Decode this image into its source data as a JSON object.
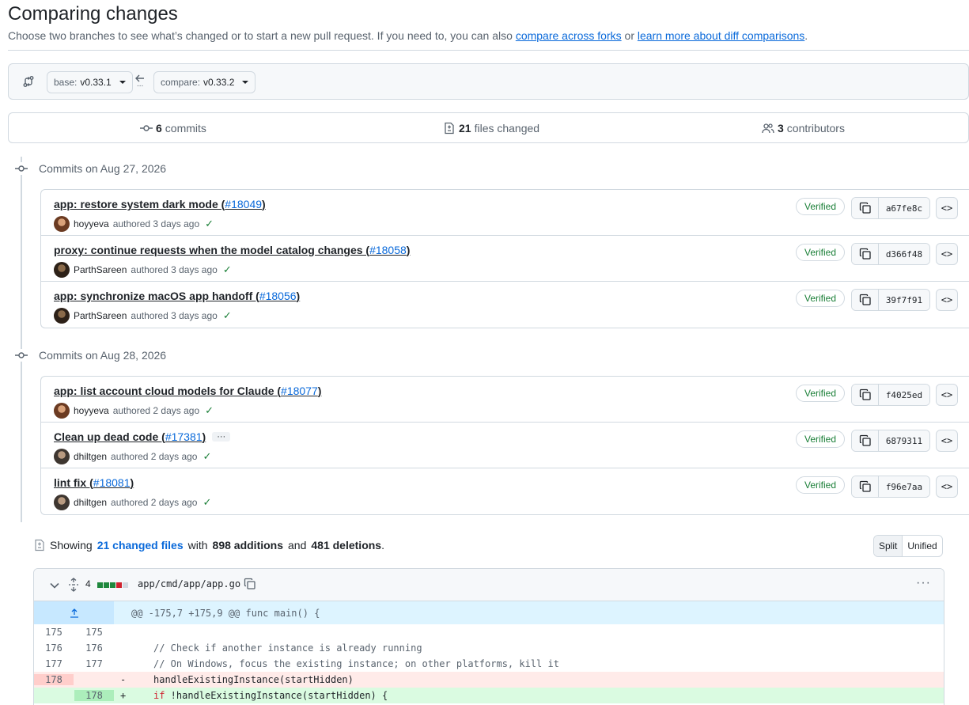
{
  "page": {
    "title": "Comparing changes",
    "subtitle_text": "Choose two branches to see what’s changed or to start a new pull request. If you need to, you can also",
    "subtitle_link1": "compare across forks",
    "subtitle_or": "or",
    "subtitle_link2": "learn more about diff comparisons",
    "subtitle_end": "."
  },
  "range": {
    "base_prefix": "base:",
    "base_value": "v0.33.1",
    "compare_prefix": "compare:",
    "compare_value": "v0.33.2",
    "ellipsis": "..."
  },
  "stats": {
    "commits_count": "6",
    "commits_label": "commits",
    "files_count": "21",
    "files_label": "files changed",
    "contributors_count": "3",
    "contributors_label": "contributors"
  },
  "groups": [
    {
      "heading": "Commits on Aug 27, 2026",
      "commits": [
        {
          "message": "app: restore system dark mode (",
          "pr": "#18049",
          "close": ")",
          "author": "hoyyeva",
          "time": "authored 3 days ago",
          "status": "Verified",
          "sha": "a67fe8c"
        },
        {
          "message": "proxy: continue requests when the model catalog changes (",
          "pr": "#18058",
          "close": ")",
          "author": "ParthSareen",
          "time": "authored 3 days ago",
          "status": "Verified",
          "sha": "d366f48"
        },
        {
          "message": "app: synchronize macOS app handoff (",
          "pr": "#18056",
          "close": ")",
          "author": "ParthSareen",
          "time": "authored 3 days ago",
          "status": "Verified",
          "sha": "39f7f91"
        }
      ]
    },
    {
      "heading": "Commits on Aug 28, 2026",
      "commits": [
        {
          "message": "app: list account cloud models for Claude (",
          "pr": "#18077",
          "close": ")",
          "author": "hoyyeva",
          "time": "authored 2 days ago",
          "status": "Verified",
          "sha": "f4025ed"
        },
        {
          "message": "Clean up dead code (",
          "pr": "#17381",
          "close": ")",
          "more": "···",
          "author": "dhiltgen",
          "time": "authored 2 days ago",
          "status": "Verified",
          "sha": "6879311"
        },
        {
          "message": "lint fix (",
          "pr": "#18081",
          "close": ")",
          "author": "dhiltgen",
          "time": "authored 2 days ago",
          "status": "Verified",
          "sha": "f96e7aa"
        }
      ]
    }
  ],
  "summary": {
    "showing": "Showing",
    "files_link": "21 changed files",
    "with": "with",
    "additions": "898 additions",
    "and": "and",
    "deletions": "481 deletions",
    "end": ".",
    "split_label": "Split",
    "unified_label": "Unified"
  },
  "file": {
    "change_count": "4",
    "path": "app/cmd/app/app.go",
    "menu": "···",
    "hunk_header": "@@ -175,7 +175,9 @@ func main() {",
    "lines": [
      {
        "type": "ctx",
        "old": "175",
        "new": "175",
        "sign": "",
        "text": ""
      },
      {
        "type": "ctx",
        "old": "176",
        "new": "176",
        "sign": "",
        "text": "// Check if another instance is already running"
      },
      {
        "type": "ctx",
        "old": "177",
        "new": "177",
        "sign": "",
        "text": "// On Windows, focus the existing instance; on other platforms, kill it"
      },
      {
        "type": "del",
        "old": "178",
        "new": "",
        "sign": "-",
        "text": "handleExistingInstance(startHidden)"
      },
      {
        "type": "add",
        "old": "",
        "new": "178",
        "sign": "+",
        "kw": "if",
        "text": " !handleExistingInstance(startHidden) {"
      }
    ]
  },
  "colors": {
    "link": "#0969da",
    "verified": "#1a7f37",
    "addition": "#1f883d",
    "deletion": "#cf222e"
  },
  "icons": {
    "range": "git-compare-icon",
    "arrow": "arrow-left-icon",
    "commits": "git-commit-icon",
    "files": "file-diff-icon",
    "contributors": "people-icon",
    "copy": "copy-icon",
    "browse": "code-icon"
  }
}
